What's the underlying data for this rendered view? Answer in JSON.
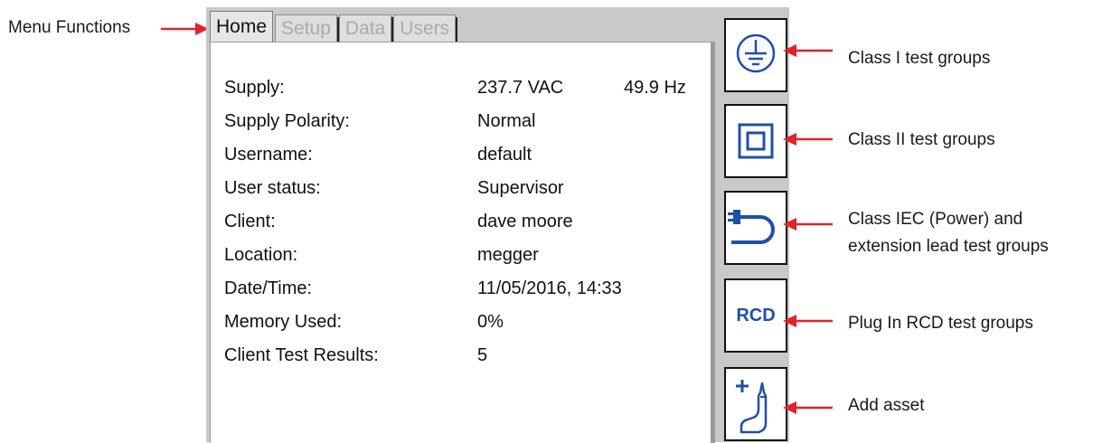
{
  "callouts": {
    "menu_functions": "Menu Functions",
    "class1": "Class I test groups",
    "class2": "Class II test groups",
    "iec_line1": "Class IEC (Power) and",
    "iec_line2": "extension lead test groups",
    "rcd": "Plug In RCD test groups",
    "add_asset": "Add asset"
  },
  "tabs": [
    {
      "label": "Home",
      "active": true
    },
    {
      "label": "Setup",
      "active": false
    },
    {
      "label": "Data",
      "active": false
    },
    {
      "label": "Users",
      "active": false
    }
  ],
  "home": {
    "rows": [
      {
        "label": "Supply:",
        "value": "237.7 VAC",
        "extra": "49.9 Hz"
      },
      {
        "label": "Supply Polarity:",
        "value": "Normal"
      },
      {
        "label": "Username:",
        "value": "default"
      },
      {
        "label": "User status:",
        "value": "Supervisor"
      },
      {
        "label": "Client:",
        "value": "dave moore"
      },
      {
        "label": "Location:",
        "value": "megger"
      },
      {
        "label": "Date/Time:",
        "value": "11/05/2016, 14:33"
      },
      {
        "label": "Memory Used:",
        "value": "0%"
      },
      {
        "label": "Client Test Results:",
        "value": "5"
      }
    ]
  },
  "buttons": {
    "rcd_text": "RCD",
    "class1_icon": "earth-ground-icon",
    "class2_icon": "double-square-icon",
    "iec_icon": "iec-lead-icon",
    "add_asset_icon": "add-asset-icon"
  },
  "colors": {
    "arrow": "#e1232b",
    "icon_blue": "#1f4fa8"
  }
}
